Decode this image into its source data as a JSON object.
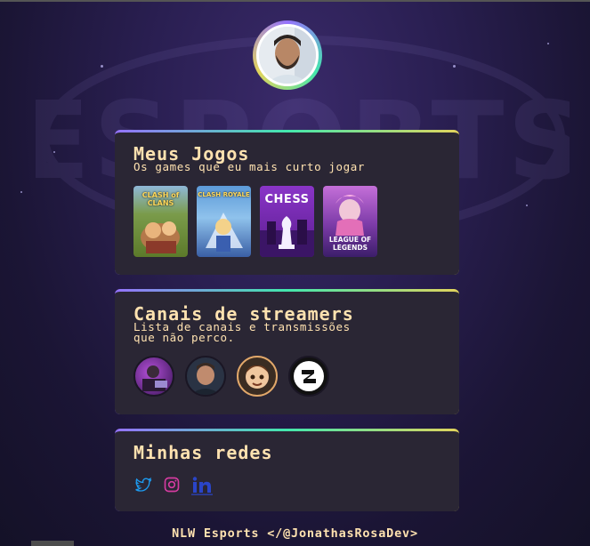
{
  "profile": {
    "avatar_icon": "profile-photo"
  },
  "games_card": {
    "title": "Meus Jogos",
    "subtitle": "Os games que eu mais curto jogar",
    "games": [
      {
        "label": "CLASH of CLANS",
        "color": "#6b8e3a"
      },
      {
        "label": "CLASH ROYALE",
        "color": "#3e6db5"
      },
      {
        "label": "CHESS",
        "color": "#6a2ca0"
      },
      {
        "label": "LEAGUE OF LEGENDS",
        "color": "#9a4fb5"
      }
    ]
  },
  "streamers_card": {
    "title": "Canais de streamers",
    "subtitle_line1": "Lista de canais e transmissões",
    "subtitle_line2": "que não perco.",
    "streamers": [
      {
        "icon": "streamer-avatar-1"
      },
      {
        "icon": "streamer-avatar-2"
      },
      {
        "icon": "streamer-avatar-3"
      },
      {
        "icon": "streamer-avatar-4"
      }
    ]
  },
  "socials_card": {
    "title": "Minhas redes",
    "links": [
      {
        "icon": "twitter-icon",
        "color": "#1da1f2"
      },
      {
        "icon": "instagram-icon",
        "color": "#c13584"
      },
      {
        "icon": "linkedin-icon",
        "color": "#2a45c8"
      }
    ]
  },
  "footer": {
    "text": "NLW Esports </@JonathasRosaDev>"
  },
  "colors": {
    "accent_text": "#ffe2b0",
    "card_bg": "#2a2634"
  }
}
